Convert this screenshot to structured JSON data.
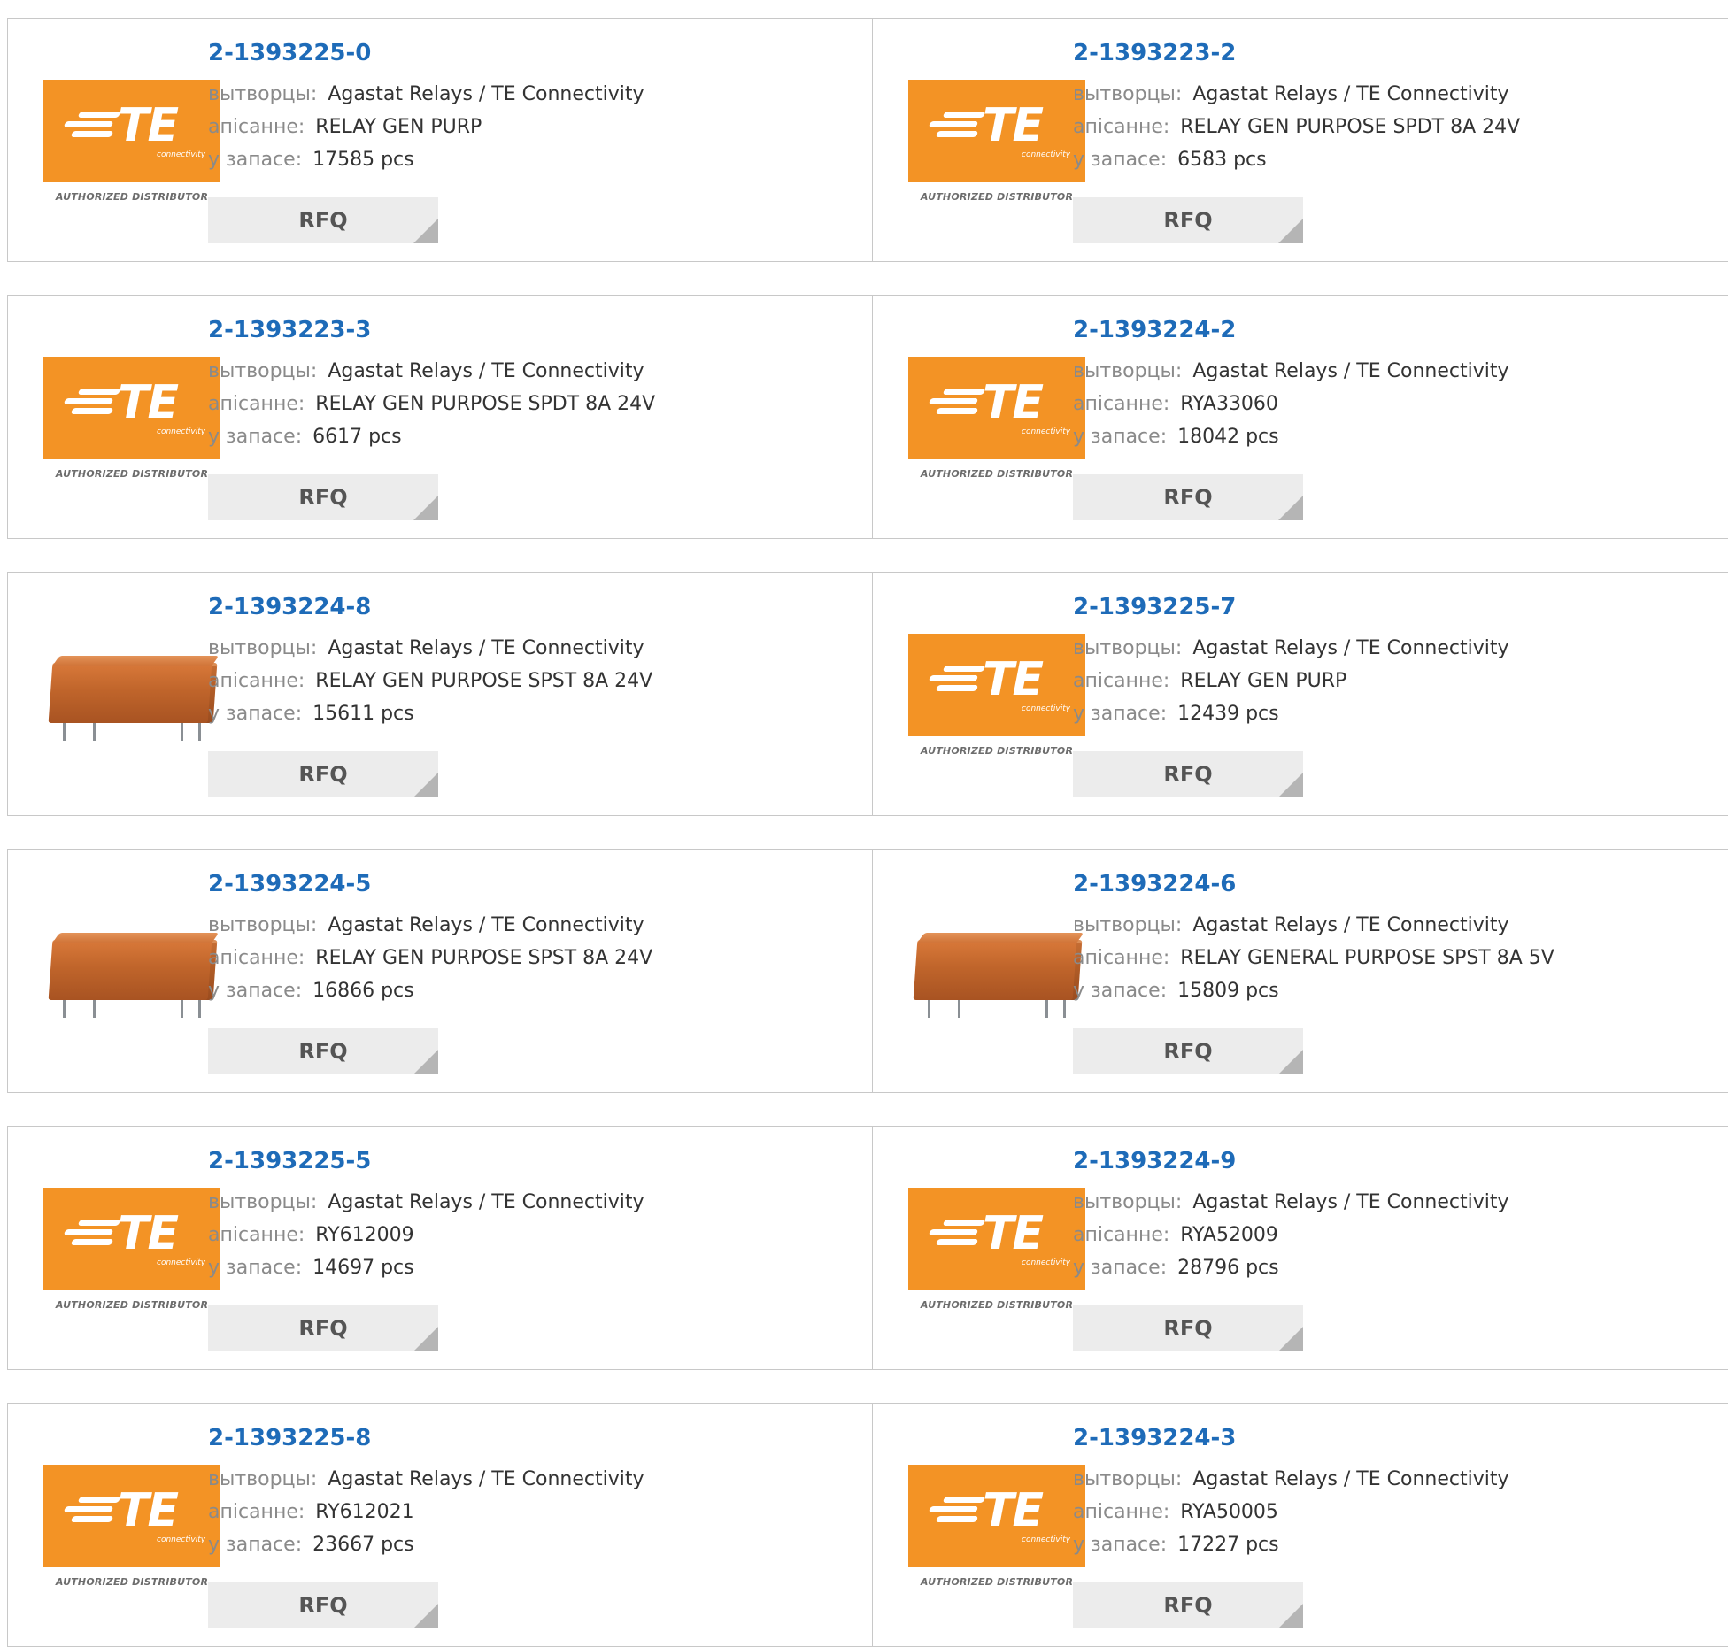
{
  "labels": {
    "manufacturer": "вытворцы:",
    "description": "апісанне:",
    "stock": "у запасе:",
    "rfq": "RFQ"
  },
  "logo": {
    "letters": "TE",
    "sub": "connectivity",
    "distributor": "AUTHORIZED DISTRIBUTOR"
  },
  "colors": {
    "accent_link": "#1e6bb8",
    "te_orange": "#f39325"
  },
  "products": [
    {
      "part": "2-1393225-0",
      "manufacturer": "Agastat Relays / TE Connectivity",
      "description": "RELAY GEN PURP",
      "stock": "17585 pcs",
      "image": "te-logo"
    },
    {
      "part": "2-1393223-2",
      "manufacturer": "Agastat Relays / TE Connectivity",
      "description": "RELAY GEN PURPOSE SPDT 8A 24V",
      "stock": "6583 pcs",
      "image": "te-logo"
    },
    {
      "part": "2-1393223-3",
      "manufacturer": "Agastat Relays / TE Connectivity",
      "description": "RELAY GEN PURPOSE SPDT 8A 24V",
      "stock": "6617 pcs",
      "image": "te-logo"
    },
    {
      "part": "2-1393224-2",
      "manufacturer": "Agastat Relays / TE Connectivity",
      "description": "RYA33060",
      "stock": "18042 pcs",
      "image": "te-logo"
    },
    {
      "part": "2-1393224-8",
      "manufacturer": "Agastat Relays / TE Connectivity",
      "description": "RELAY GEN PURPOSE SPST 8A 24V",
      "stock": "15611 pcs",
      "image": "relay"
    },
    {
      "part": "2-1393225-7",
      "manufacturer": "Agastat Relays / TE Connectivity",
      "description": "RELAY GEN PURP",
      "stock": "12439 pcs",
      "image": "te-logo"
    },
    {
      "part": "2-1393224-5",
      "manufacturer": "Agastat Relays / TE Connectivity",
      "description": "RELAY GEN PURPOSE SPST 8A 24V",
      "stock": "16866 pcs",
      "image": "relay"
    },
    {
      "part": "2-1393224-6",
      "manufacturer": "Agastat Relays / TE Connectivity",
      "description": "RELAY GENERAL PURPOSE SPST 8A 5V",
      "stock": "15809 pcs",
      "image": "relay"
    },
    {
      "part": "2-1393225-5",
      "manufacturer": "Agastat Relays / TE Connectivity",
      "description": "RY612009",
      "stock": "14697 pcs",
      "image": "te-logo"
    },
    {
      "part": "2-1393224-9",
      "manufacturer": "Agastat Relays / TE Connectivity",
      "description": "RYA52009",
      "stock": "28796 pcs",
      "image": "te-logo"
    },
    {
      "part": "2-1393225-8",
      "manufacturer": "Agastat Relays / TE Connectivity",
      "description": "RY612021",
      "stock": "23667 pcs",
      "image": "te-logo"
    },
    {
      "part": "2-1393224-3",
      "manufacturer": "Agastat Relays / TE Connectivity",
      "description": "RYA50005",
      "stock": "17227 pcs",
      "image": "te-logo"
    }
  ]
}
